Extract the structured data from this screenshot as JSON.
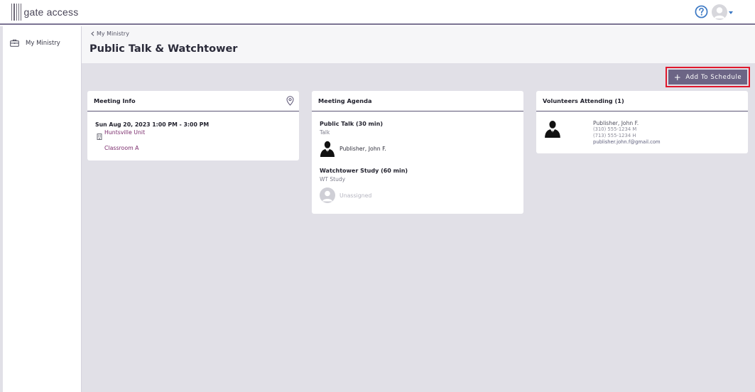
{
  "app": {
    "logo_text": "gate access"
  },
  "sidebar": {
    "items": [
      {
        "label": "My Ministry",
        "icon": "briefcase-icon"
      }
    ]
  },
  "breadcrumb": {
    "back_label": "My Ministry"
  },
  "page": {
    "title": "Public Talk & Watchtower"
  },
  "toolbar": {
    "add_label": "Add To Schedule"
  },
  "meeting_info": {
    "header": "Meeting Info",
    "datetime": "Sun Aug 20, 2023 1:00 PM - 3:00 PM",
    "location": "Huntsville Unit",
    "room": "Classroom A"
  },
  "agenda": {
    "header": "Meeting Agenda",
    "items": [
      {
        "title": "Public Talk (30 min)",
        "subtitle": "Talk",
        "assignee": "Publisher, John F."
      },
      {
        "title": "Watchtower Study (60 min)",
        "subtitle": "WT Study",
        "assignee": "Unassigned"
      }
    ]
  },
  "volunteers": {
    "header": "Volunteers Attending (1)",
    "items": [
      {
        "name": "Publisher, John F.",
        "phone_mobile": "(310) 555-1234 M",
        "phone_home": "(713) 555-1234 H",
        "email": "publisher.john.f@gmail.com"
      }
    ]
  },
  "colors": {
    "accent": "#6c6585",
    "link": "#7a2a6b",
    "highlight_border": "#e0182d",
    "help_icon": "#3b78c4",
    "main_bg": "#e1e0e7"
  }
}
